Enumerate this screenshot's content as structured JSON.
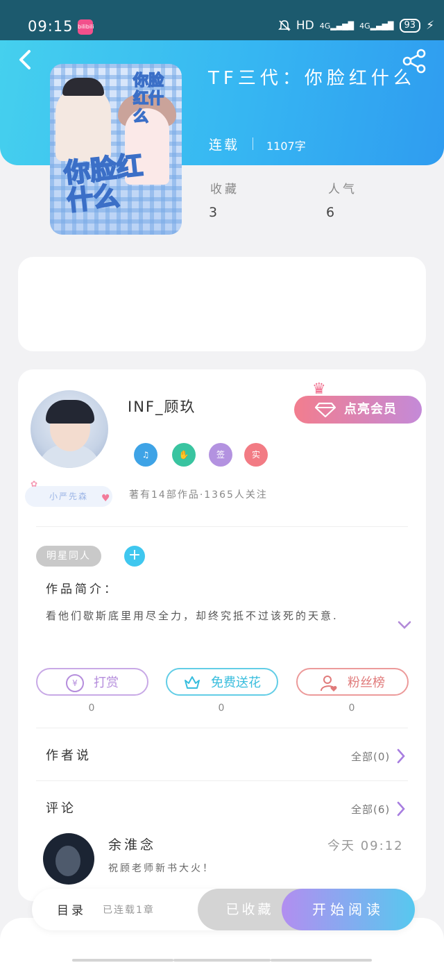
{
  "status_bar": {
    "time": "09:15",
    "app_badge": "bilibili",
    "network": "HD",
    "signal1": "4G",
    "signal2": "4G",
    "battery": "93"
  },
  "book": {
    "title": "TF三代：你脸红什么",
    "status": "连载",
    "word_count": "1107字",
    "cover_title": "你脸红什么",
    "cover_top_text": "你脸红什么",
    "favorites_label": "收藏",
    "favorites_value": "3",
    "popularity_label": "人气",
    "popularity_value": "6"
  },
  "author": {
    "name": "INF_顾玖",
    "vip_label": "点亮会员",
    "badges": [
      {
        "label": "",
        "color": "#3ea3e6"
      },
      {
        "label": "",
        "color": "#39c4a0"
      },
      {
        "label": "签",
        "color": "#b392e0"
      },
      {
        "label": "实",
        "color": "#f27b84"
      }
    ],
    "stats": "著有14部作品·1365人关注",
    "level_tag": "小严先森"
  },
  "tags": {
    "chip": "明星同人",
    "add": "+"
  },
  "intro": {
    "label": "作品简介：",
    "text": "看他们歇斯底里用尽全力，却终究抵不过该死的天意."
  },
  "actions": {
    "reward": {
      "label": "打赏",
      "count": "0",
      "icon": "¥",
      "color": "#b58ddc"
    },
    "flower": {
      "label": "免费送花",
      "count": "0",
      "color": "#49c6e2"
    },
    "fans": {
      "label": "粉丝榜",
      "count": "0",
      "color": "#e87d7d"
    }
  },
  "author_says": {
    "title": "作者说",
    "more": "全部(0)"
  },
  "comments": {
    "title": "评论",
    "more": "全部(6)",
    "items": [
      {
        "name": "余淮念",
        "time": "今天 09:12",
        "text": "祝顾老师新书大火！"
      }
    ]
  },
  "bottom": {
    "toc_label": "目录",
    "toc_sub": "已连载1章",
    "fav_label": "已收藏",
    "read_label": "开始阅读"
  }
}
